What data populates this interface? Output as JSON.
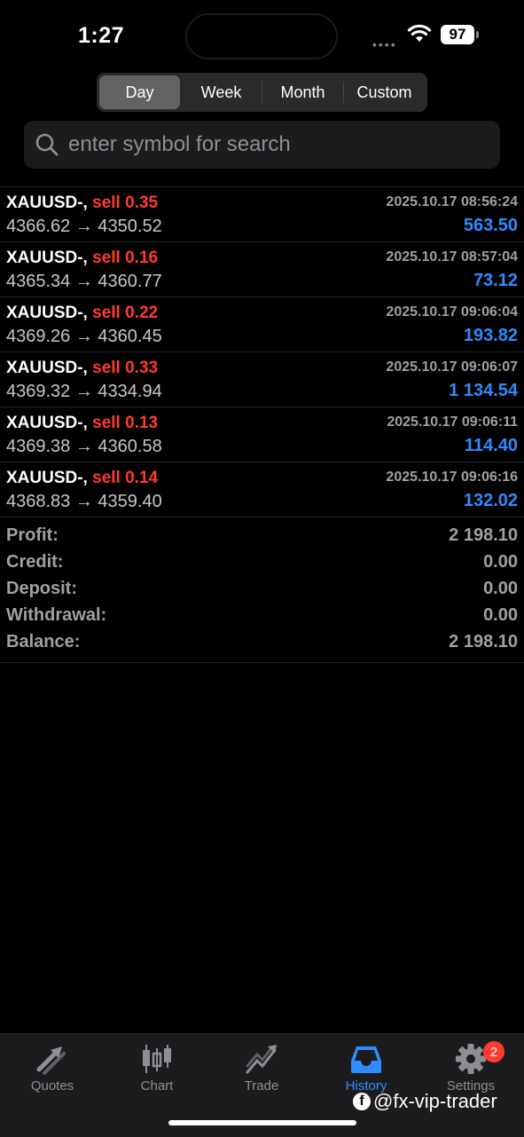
{
  "status": {
    "time": "1:27",
    "battery": "97"
  },
  "period_tabs": [
    {
      "label": "Day",
      "active": true
    },
    {
      "label": "Week",
      "active": false
    },
    {
      "label": "Month",
      "active": false
    },
    {
      "label": "Custom",
      "active": false
    }
  ],
  "search": {
    "placeholder": "enter symbol for search"
  },
  "deals": [
    {
      "symbol": "XAUUSD-,",
      "side": "sell 0.35",
      "time": "2025.10.17 08:56:24",
      "open": "4366.62",
      "close": "4350.52",
      "profit": "563.50"
    },
    {
      "symbol": "XAUUSD-,",
      "side": "sell 0.16",
      "time": "2025.10.17 08:57:04",
      "open": "4365.34",
      "close": "4360.77",
      "profit": "73.12"
    },
    {
      "symbol": "XAUUSD-,",
      "side": "sell 0.22",
      "time": "2025.10.17 09:06:04",
      "open": "4369.26",
      "close": "4360.45",
      "profit": "193.82"
    },
    {
      "symbol": "XAUUSD-,",
      "side": "sell 0.33",
      "time": "2025.10.17 09:06:07",
      "open": "4369.32",
      "close": "4334.94",
      "profit": "1 134.54"
    },
    {
      "symbol": "XAUUSD-,",
      "side": "sell 0.13",
      "time": "2025.10.17 09:06:11",
      "open": "4369.38",
      "close": "4360.58",
      "profit": "114.40"
    },
    {
      "symbol": "XAUUSD-,",
      "side": "sell 0.14",
      "time": "2025.10.17 09:06:16",
      "open": "4368.83",
      "close": "4359.40",
      "profit": "132.02"
    }
  ],
  "arrow": "→",
  "summary": {
    "profit_label": "Profit:",
    "profit": "2 198.10",
    "credit_label": "Credit:",
    "credit": "0.00",
    "deposit_label": "Deposit:",
    "deposit": "0.00",
    "withdrawal_label": "Withdrawal:",
    "withdrawal": "0.00",
    "balance_label": "Balance:",
    "balance": "2 198.10"
  },
  "tabbar": {
    "items": [
      {
        "label": "Quotes",
        "icon": "quotes-arrows-icon",
        "active": false
      },
      {
        "label": "Chart",
        "icon": "candlestick-icon",
        "active": false
      },
      {
        "label": "Trade",
        "icon": "trade-trend-icon",
        "active": false
      },
      {
        "label": "History",
        "icon": "inbox-tray-icon",
        "active": true
      },
      {
        "label": "Settings",
        "icon": "gear-icon",
        "active": false
      }
    ],
    "settings_badge": "2"
  },
  "watermark": "@fx-vip-trader",
  "colors": {
    "sell": "#ff3b30",
    "profit": "#2f8cff",
    "active_tab": "#2f8cff",
    "background": "#000000"
  }
}
